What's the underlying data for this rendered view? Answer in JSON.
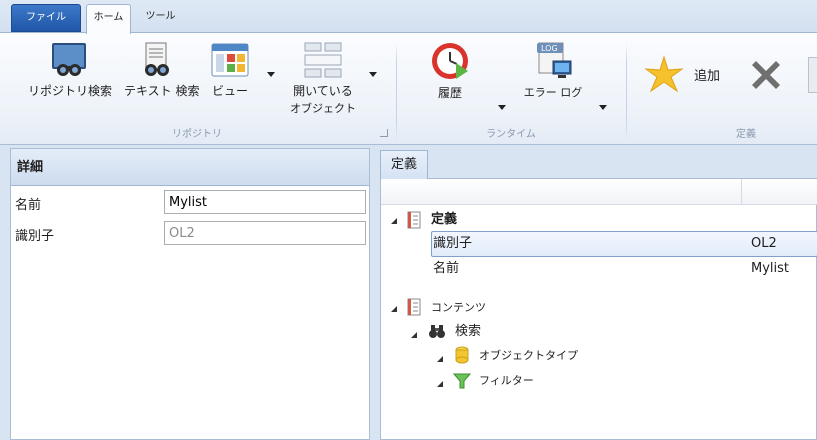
{
  "tabs": {
    "file": "ファイル",
    "home": "ホーム",
    "tools": "ツール"
  },
  "ribbon": {
    "repository_search": "リポジトリ検索",
    "text_search": "テキスト 検索",
    "view": "ビュー",
    "open_objects_line1": "開いている",
    "open_objects_line2": "オブジェクト",
    "history": "履歴",
    "error_log": "エラー ログ",
    "add": "追加",
    "group_repository": "リポジトリ",
    "group_runtime": "ランタイム",
    "group_definition": "定義"
  },
  "details": {
    "header": "詳細",
    "name_label": "名前",
    "name_value": "Mylist",
    "id_label": "識別子",
    "id_value": "OL2"
  },
  "definition_pane": {
    "tab": "定義",
    "tree": {
      "definition_node": "定義",
      "id_label": "識別子",
      "id_value": "OL2",
      "name_label": "名前",
      "name_value": "Mylist",
      "contents_node": "コンテンツ",
      "search_node": "検索",
      "object_type_node": "オブジェクトタイプ",
      "filter_node": "フィルター"
    }
  },
  "colors": {
    "accent": "#1f56a8",
    "pane_header": "#cddcef",
    "selection_border": "#7da2ce"
  },
  "icons": [
    "repository-search-icon",
    "binoculars-icon",
    "view-icon",
    "open-objects-icon",
    "history-clock-icon",
    "error-log-icon",
    "add-star-icon",
    "delete-icon",
    "document-icon",
    "folder-db-icon",
    "filter-funnel-icon"
  ]
}
